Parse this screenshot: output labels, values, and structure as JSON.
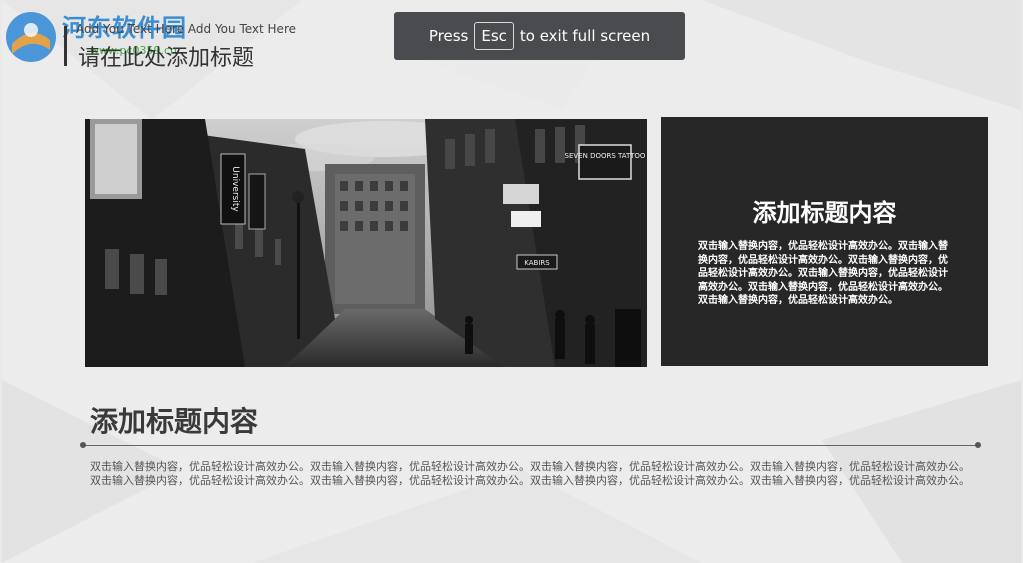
{
  "watermark": {
    "name": "河东软件园",
    "url": "www.pc0359.cn"
  },
  "header": {
    "subtitle": "Add You Text Here Add You Text Here",
    "title": "请在此处添加标题"
  },
  "fullscreen_hint": {
    "before": "Press",
    "key": "Esc",
    "after": "to exit full screen"
  },
  "photo": {
    "signs": [
      "University",
      "SEVEN DOORS TATTOO",
      "KABIRS"
    ]
  },
  "card": {
    "title": "添加标题内容",
    "body": "双击输入替换内容，优品轻松设计高效办公。双击输入替换内容，优品轻松设计高效办公。双击输入替换内容，优品轻松设计高效办公。双击输入替换内容，优品轻松设计高效办公。双击输入替换内容，优品轻松设计高效办公。双击输入替换内容，优品轻松设计高效办公。"
  },
  "section": {
    "title": "添加标题内容",
    "body": "双击输入替换内容，优品轻松设计高效办公。双击输入替换内容，优品轻松设计高效办公。双击输入替换内容，优品轻松设计高效办公。双击输入替换内容，优品轻松设计高效办公。双击输入替换内容，优品轻松设计高效办公。双击输入替换内容，优品轻松设计高效办公。双击输入替换内容，优品轻松设计高效办公。双击输入替换内容，优品轻松设计高效办公。"
  },
  "colors": {
    "card_bg": "#272727",
    "slide_bg": "#ececec",
    "watermark_blue": "#1e7fd0",
    "watermark_green": "#2aa12a"
  }
}
